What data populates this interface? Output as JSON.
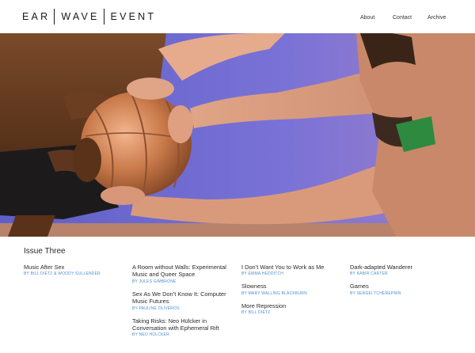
{
  "header": {
    "logo": {
      "word1": "EAR",
      "word2": "WAVE",
      "word3": "EVENT"
    },
    "nav": [
      {
        "label": "About"
      },
      {
        "label": "Contact"
      },
      {
        "label": "Archive"
      }
    ]
  },
  "hero": {
    "image": "photograph-performers-holding-copper-sphere"
  },
  "issue": {
    "title": "Issue Three",
    "columns": [
      [
        {
          "title": "Music After Sex",
          "author": "BY BILL DIETZ & WOODY SULLENDER"
        }
      ],
      [
        {
          "title": "A Room without Walls: Experimental Music and Queer Space",
          "author": "BY JULES GIMBRONE"
        },
        {
          "title": "Sex As We Don’t Know It: Computer Music Futures",
          "author": "BY PAULINE OLIVEROS"
        },
        {
          "title": "Taking Risks: Neo Hülcker in Conversation with Ephemeral Rift",
          "author": "BY NEO HÜLCKER"
        }
      ],
      [
        {
          "title": "I Don’t Want You to Work as Me",
          "author": "BY EMMA HEDDITCH"
        },
        {
          "title": "Slowness",
          "author": "BY MARY WALLING BLACKBURN"
        },
        {
          "title": "More Repression",
          "author": "BY BILL DIETZ"
        }
      ],
      [
        {
          "title": "Dark-adapted Wanderer",
          "author": "BY KABIR CARTER"
        },
        {
          "title": "Games",
          "author": "BY SERGEI TCHEREPNIN"
        }
      ]
    ]
  }
}
